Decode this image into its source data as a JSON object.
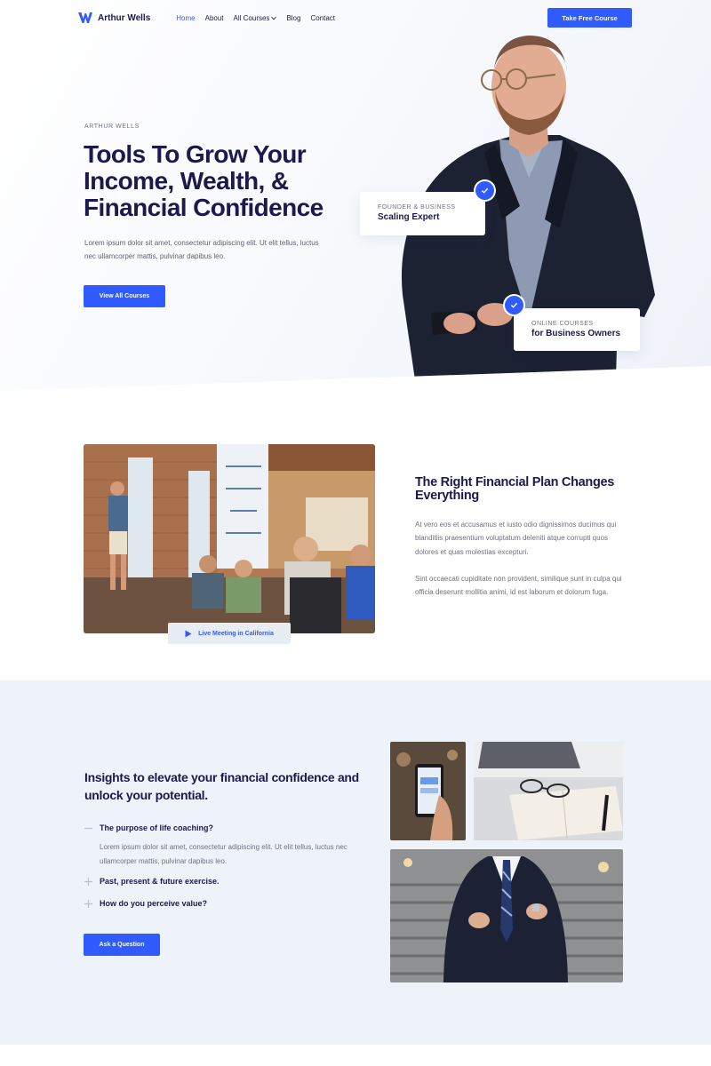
{
  "nav": {
    "brand": "Arthur Wells",
    "items": [
      {
        "label": "Home",
        "active": true
      },
      {
        "label": "About"
      },
      {
        "label": "All Courses",
        "has_dropdown": true
      },
      {
        "label": "Blog"
      },
      {
        "label": "Contact"
      }
    ],
    "cta": "Take Free Course"
  },
  "hero": {
    "eyebrow": "ARTHUR WELLS",
    "title_lines": [
      "Tools To Grow Your",
      "Income, Wealth, &",
      "Financial Confidence"
    ],
    "description": "Lorem ipsum dolor sit amet, consectetur adipiscing elit. Ut elit tellus, luctus nec ullamcorper mattis, pulvinar dapibus leo.",
    "button": "View All Courses",
    "badge1": {
      "small": "FOUNDER & BUSINESS",
      "big": "Scaling Expert"
    },
    "badge2": {
      "small": "ONLINE COURSES",
      "big": "for Business Owners"
    }
  },
  "plan": {
    "video_label": "Live Meeting in California",
    "title": "The Right Financial Plan Changes Everything",
    "paragraph1": "At vero eos et accusamus et iusto odio dignissimos ducimus qui blanditiis praesentium voluptatum deleniti atque corrupti quos dolores et quas molestias excepturi.",
    "paragraph2": "Sint occaecati cupiditate non provident, similique sunt in culpa qui officia deserunt mollitia animi, id est laborum et dolorum fuga."
  },
  "insights": {
    "title": "Insights to elevate your financial confidence and unlock your potential.",
    "accordion": [
      {
        "question": "The purpose of life coaching?",
        "open": true,
        "answer": "Lorem ipsum dolor sit amet, consectetur adipiscing elit. Ut elit tellus, luctus nec ullamcorper mattis, pulvinar dapibus leo."
      },
      {
        "question": "Past, present & future exercise.",
        "open": false
      },
      {
        "question": "How do you perceive value?",
        "open": false
      }
    ],
    "button": "Ask a Question"
  },
  "colors": {
    "accent": "#2f5bff",
    "heading": "#1c1a4d",
    "body": "#6f7181",
    "section_bg": "#eef3f9"
  }
}
